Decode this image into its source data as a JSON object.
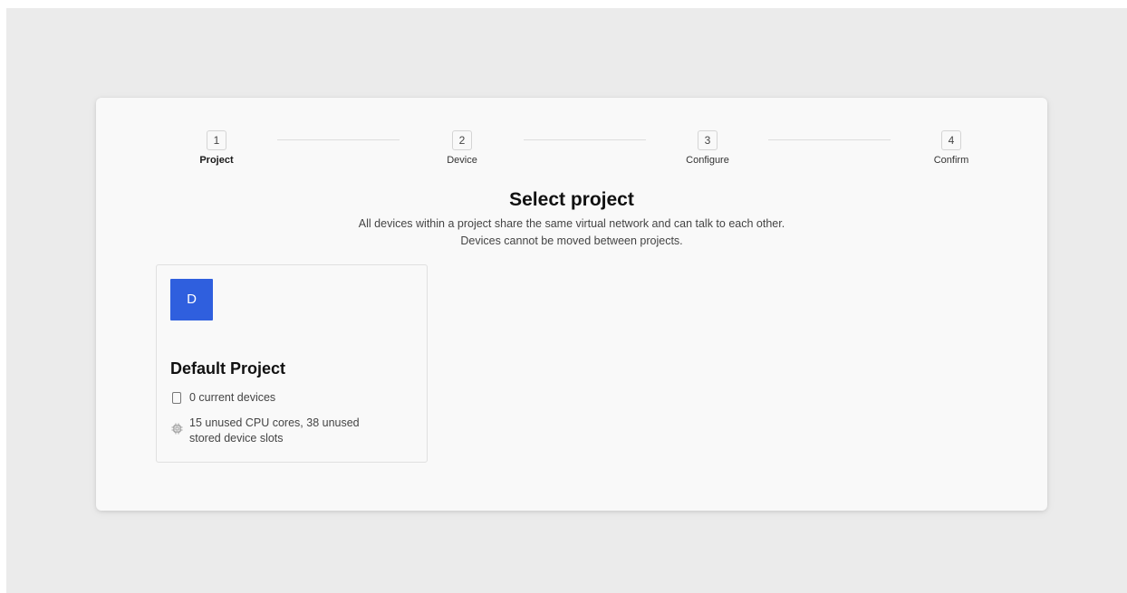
{
  "stepper": {
    "steps": [
      {
        "number": "1",
        "label": "Project",
        "active": true
      },
      {
        "number": "2",
        "label": "Device",
        "active": false
      },
      {
        "number": "3",
        "label": "Configure",
        "active": false
      },
      {
        "number": "4",
        "label": "Confirm",
        "active": false
      }
    ]
  },
  "header": {
    "title": "Select project",
    "description_line1": "All devices within a project share the same virtual network and can talk to each other.",
    "description_line2": "Devices cannot be moved between projects."
  },
  "projects": [
    {
      "avatar_letter": "D",
      "avatar_color": "#2f5fde",
      "name": "Default Project",
      "devices_text": "0 current devices",
      "resources_line1": "15 unused CPU cores, 38 unused",
      "resources_line2": "stored device slots",
      "device_icon": "phone-outline-icon",
      "resources_icon": "cpu-chip-icon"
    }
  ]
}
